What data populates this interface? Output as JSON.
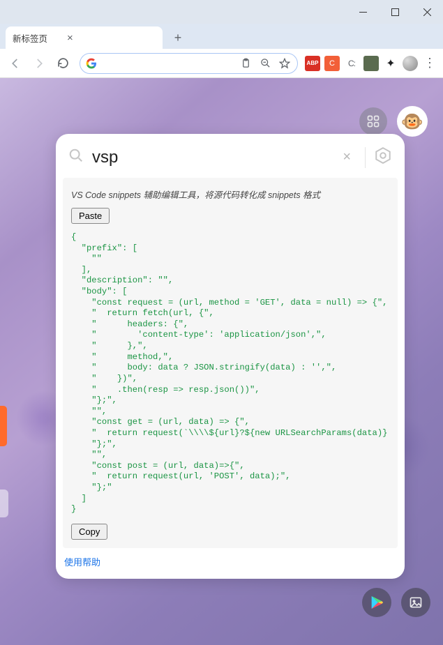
{
  "window": {
    "title": "新标签页"
  },
  "tab": {
    "label": "新标签页"
  },
  "omnibox": {
    "value": "",
    "placeholder": ""
  },
  "card": {
    "search_value": "vsp",
    "description": "VS Code snippets 辅助编辑工具，将源代码转化成 snippets 格式",
    "paste_label": "Paste",
    "copy_label": "Copy",
    "help_label": "使用帮助",
    "code_lines": [
      "{",
      "  \"prefix\": [",
      "    \"\"",
      "  ],",
      "  \"description\": \"\",",
      "  \"body\": [",
      "    \"const request = (url, method = 'GET', data = null) => {\",",
      "    \"  return fetch(url, {\",",
      "    \"      headers: {\",",
      "    \"        'content-type': 'application/json',\",",
      "    \"      },\",",
      "    \"      method,\",",
      "    \"      body: data ? JSON.stringify(data) : '',\",",
      "    \"    })\",",
      "    \"    .then(resp => resp.json())\",",
      "    \"};\",",
      "    \"\",",
      "    \"const get = (url, data) => {\",",
      "    \"  return request(`\\\\\\\\${url}?${new URLSearchParams(data)}`);\",",
      "    \"};\",",
      "    \"\",",
      "    \"const post = (url, data)=>{\",",
      "    \"  return request(url, 'POST', data);\",",
      "    \"};\"",
      "  ]",
      "}"
    ]
  }
}
